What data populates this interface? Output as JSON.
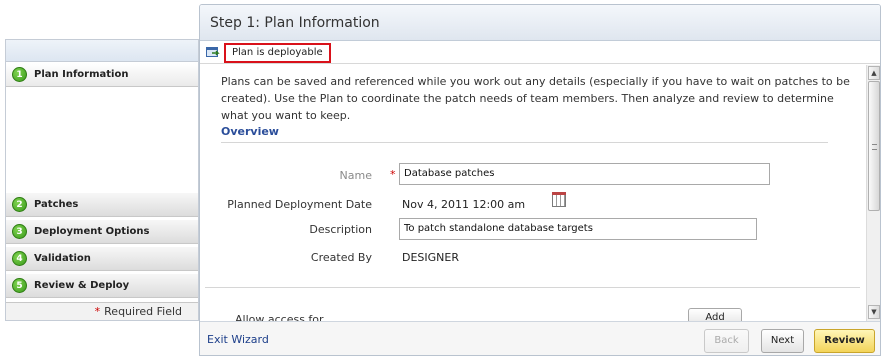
{
  "train": {
    "steps": [
      {
        "num": "1",
        "label": "Plan Information"
      },
      {
        "num": "2",
        "label": "Patches"
      },
      {
        "num": "3",
        "label": "Deployment Options"
      },
      {
        "num": "4",
        "label": "Validation"
      },
      {
        "num": "5",
        "label": "Review & Deploy"
      }
    ],
    "required_field": "Required Field",
    "required_star": "*"
  },
  "header": {
    "title": "Step 1: Plan Information"
  },
  "status": {
    "icon": "deploy-status-icon",
    "text": "Plan is deployable"
  },
  "main": {
    "intro": "Plans can be saved and referenced while you work out any details (especially if you have to wait on patches to be created). Use the Plan to coordinate the patch needs of team members. Then analyze and review to determine what you want to keep.",
    "section_title": "Overview",
    "fields": {
      "name_label": "Name",
      "name_required": "*",
      "name_value": "Database patches",
      "date_label": "Planned Deployment Date",
      "date_value": "Nov 4, 2011  12:00 am",
      "description_label": "Description",
      "description_value": "To patch standalone database targets",
      "created_by_label": "Created By",
      "created_by_value": "DESIGNER"
    },
    "access_label": "Allow access for",
    "add_button": "Add"
  },
  "footer": {
    "exit": "Exit Wizard",
    "back": "Back",
    "next": "Next",
    "review": "Review"
  }
}
